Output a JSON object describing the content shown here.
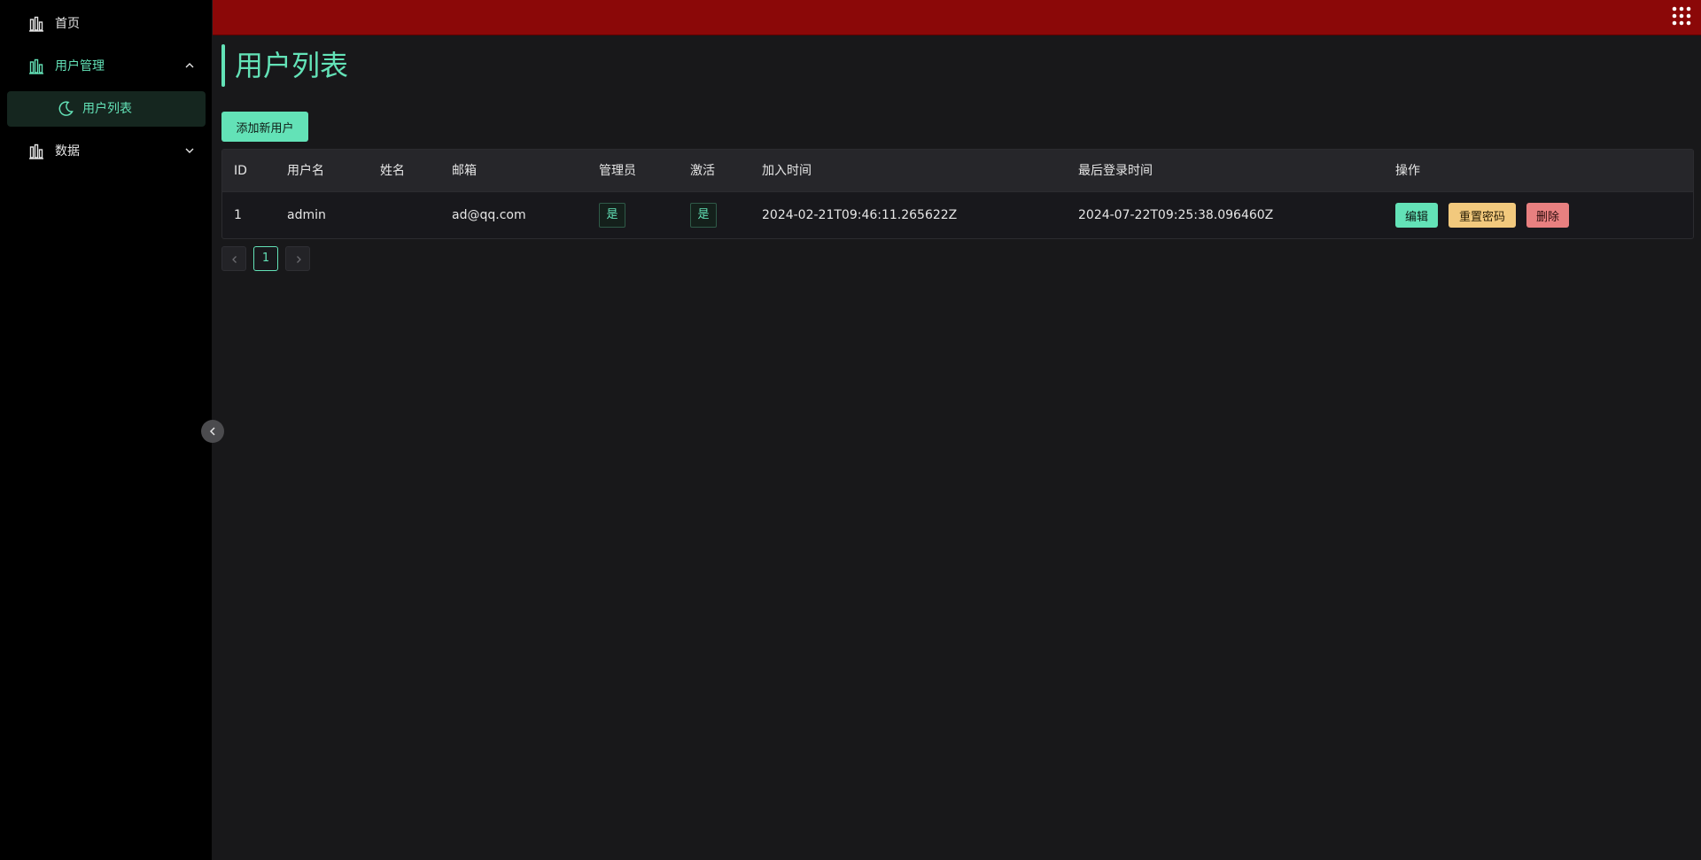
{
  "sidebar": {
    "items": [
      {
        "label": "首页",
        "icon": "bar-chart-icon"
      },
      {
        "label": "用户管理",
        "icon": "bar-chart-icon",
        "expanded": true
      },
      {
        "label": "用户列表",
        "icon": "moon-icon",
        "active": true
      },
      {
        "label": "数据",
        "icon": "bar-chart-icon",
        "expanded": false
      }
    ]
  },
  "main": {
    "title": "用户列表",
    "add_button": "添加新用户",
    "table": {
      "headers": [
        "ID",
        "用户名",
        "姓名",
        "邮箱",
        "管理员",
        "激活",
        "加入时间",
        "最后登录时间",
        "操作"
      ],
      "rows": [
        {
          "id": "1",
          "username": "admin",
          "name": "",
          "email": "ad@qq.com",
          "is_admin": "是",
          "is_active": "是",
          "joined": "2024-02-21T09:46:11.265622Z",
          "last_login": "2024-07-22T09:25:38.096460Z",
          "actions": {
            "edit": "编辑",
            "reset_password": "重置密码",
            "delete": "删除"
          }
        }
      ]
    },
    "pagination": {
      "current_page": "1"
    }
  },
  "colors": {
    "accent": "#63e2b7",
    "header": "#8b0808",
    "warning": "#f2c97d",
    "danger": "#e88080"
  }
}
